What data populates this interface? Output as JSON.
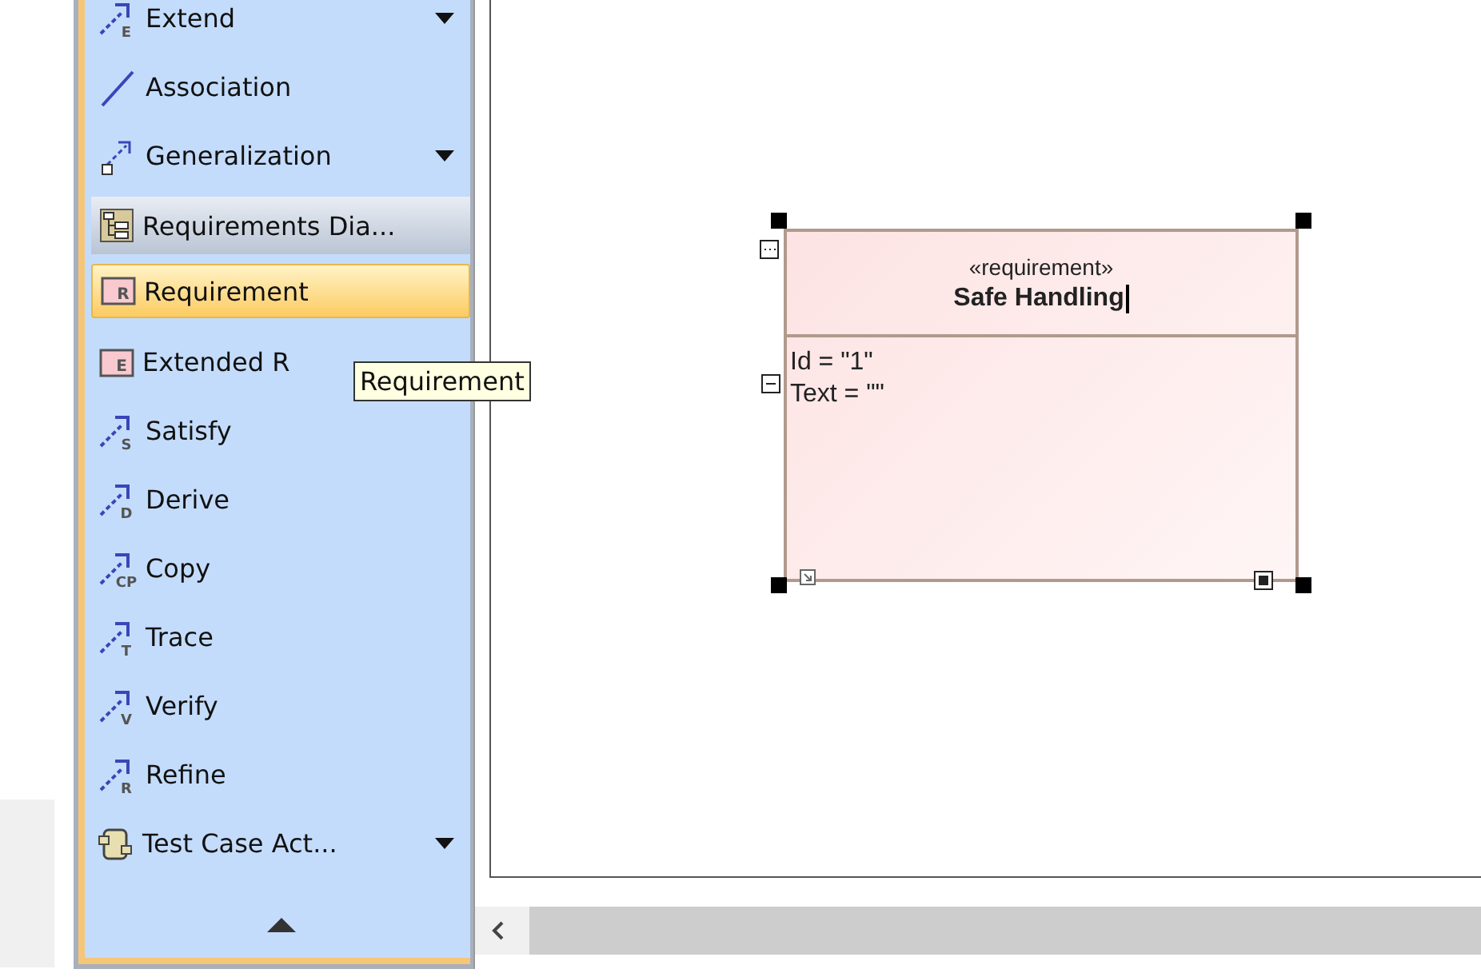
{
  "palette": {
    "items": [
      {
        "kind": "dependency",
        "label": "Extend",
        "letter": "E",
        "has_menu": true,
        "selected": false
      },
      {
        "kind": "line",
        "label": "Association",
        "has_menu": false,
        "selected": false
      },
      {
        "kind": "generalization",
        "label": "Generalization",
        "has_menu": true,
        "selected": false
      },
      {
        "kind": "header",
        "label": "Requirements Dia...",
        "has_menu": false,
        "selected": false
      },
      {
        "kind": "element",
        "label": "Requirement",
        "letter": "R",
        "has_menu": false,
        "selected": true
      },
      {
        "kind": "element",
        "label": "Extended R",
        "letter": "E",
        "has_menu": false,
        "selected": false
      },
      {
        "kind": "dependency",
        "label": "Satisfy",
        "letter": "S",
        "has_menu": false,
        "selected": false
      },
      {
        "kind": "dependency",
        "label": "Derive",
        "letter": "D",
        "has_menu": false,
        "selected": false
      },
      {
        "kind": "dependency",
        "label": "Copy",
        "letter": "CP",
        "has_menu": false,
        "selected": false
      },
      {
        "kind": "dependency",
        "label": "Trace",
        "letter": "T",
        "has_menu": false,
        "selected": false
      },
      {
        "kind": "dependency",
        "label": "Verify",
        "letter": "V",
        "has_menu": false,
        "selected": false
      },
      {
        "kind": "dependency",
        "label": "Refine",
        "letter": "R",
        "has_menu": false,
        "selected": false
      },
      {
        "kind": "testcase",
        "label": "Test Case Act...",
        "has_menu": true,
        "selected": false
      }
    ]
  },
  "tooltip": "Requirement",
  "diagram": {
    "requirement": {
      "stereotype": "«requirement»",
      "name": "Safe Handling",
      "properties": [
        "Id = \"1\"",
        "Text = \"\""
      ]
    }
  }
}
